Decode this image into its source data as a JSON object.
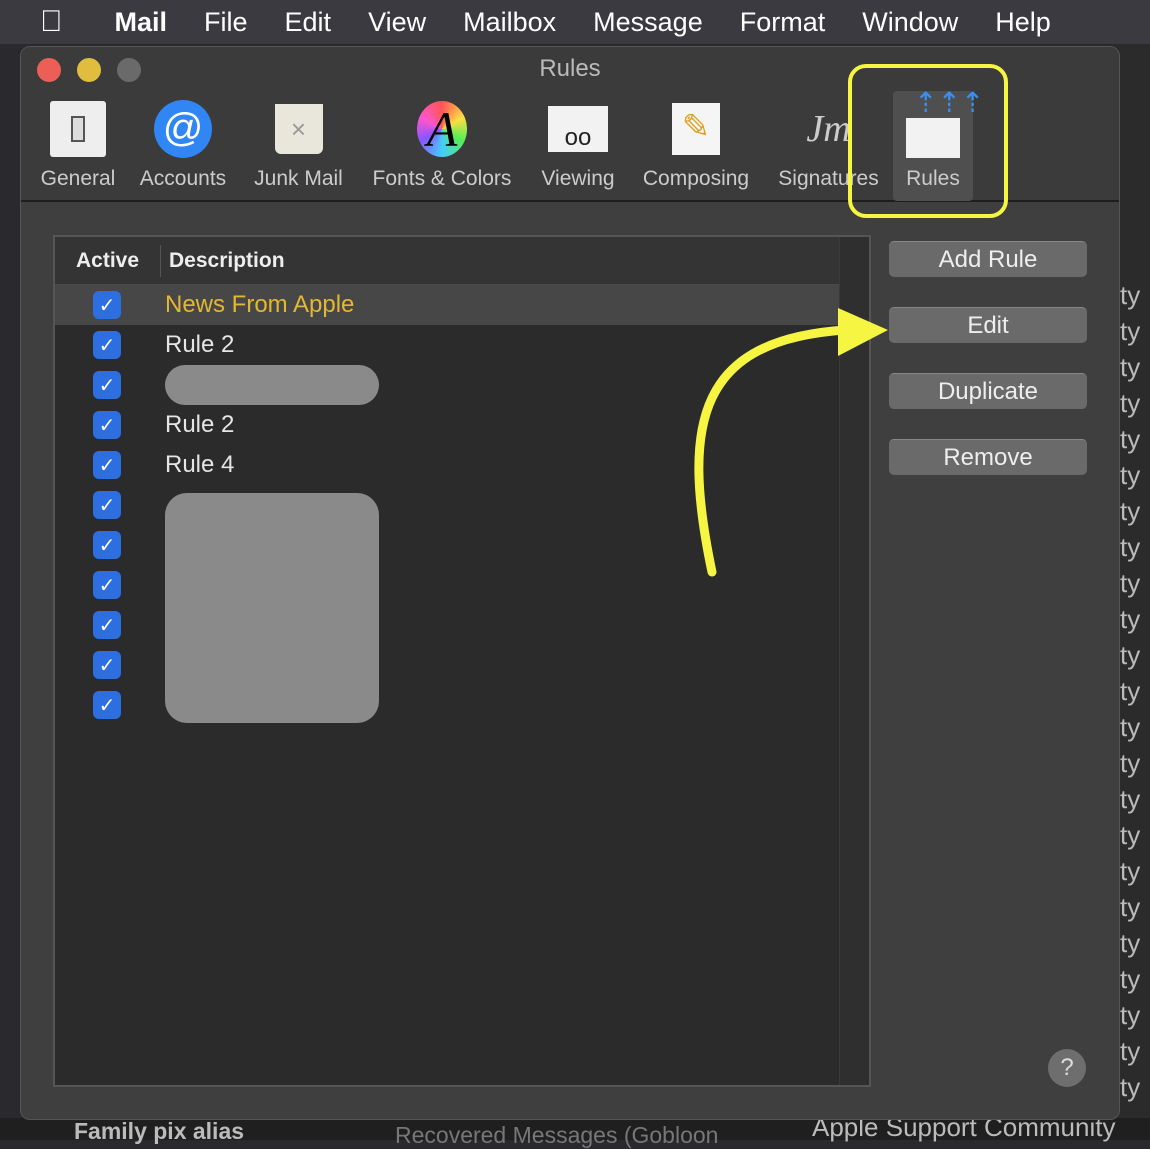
{
  "menubar": {
    "items": [
      "Mail",
      "File",
      "Edit",
      "View",
      "Mailbox",
      "Message",
      "Format",
      "Window",
      "Help"
    ]
  },
  "background": {
    "right_fragment": "ty",
    "bottom": [
      "Family pix alias",
      "Recovered Messages (Gobloon",
      "Apple Support Community"
    ]
  },
  "window": {
    "title": "Rules"
  },
  "toolbar": [
    {
      "label": "General",
      "icon": "switch-icon"
    },
    {
      "label": "Accounts",
      "icon": "at-icon"
    },
    {
      "label": "Junk Mail",
      "icon": "trash-icon"
    },
    {
      "label": "Fonts & Colors",
      "icon": "font-icon"
    },
    {
      "label": "Viewing",
      "icon": "glasses-icon"
    },
    {
      "label": "Composing",
      "icon": "pencil-icon"
    },
    {
      "label": "Signatures",
      "icon": "signature-icon"
    },
    {
      "label": "Rules",
      "icon": "envelope-arrows-icon",
      "selected": true
    }
  ],
  "table": {
    "headers": {
      "active": "Active",
      "description": "Description"
    },
    "rows": [
      {
        "active": true,
        "description": "News From Apple",
        "selected": true
      },
      {
        "active": true,
        "description": "Rule 2"
      },
      {
        "active": true,
        "description": "",
        "redacted": true
      },
      {
        "active": true,
        "description": "Rule 2"
      },
      {
        "active": true,
        "description": "Rule 4"
      },
      {
        "active": true,
        "description": "",
        "redacted": true
      },
      {
        "active": true,
        "description": "",
        "redacted": true
      },
      {
        "active": true,
        "description": "",
        "redacted": true
      },
      {
        "active": true,
        "description": "",
        "redacted": true
      },
      {
        "active": true,
        "description": "",
        "redacted": true
      },
      {
        "active": true,
        "description": "",
        "redacted": true
      }
    ]
  },
  "buttons": {
    "add": "Add Rule",
    "edit": "Edit",
    "duplicate": "Duplicate",
    "remove": "Remove",
    "help": "?"
  },
  "colors": {
    "highlight": "#f5f542",
    "selected_text": "#e2b734",
    "checkbox": "#2d6fe0"
  }
}
